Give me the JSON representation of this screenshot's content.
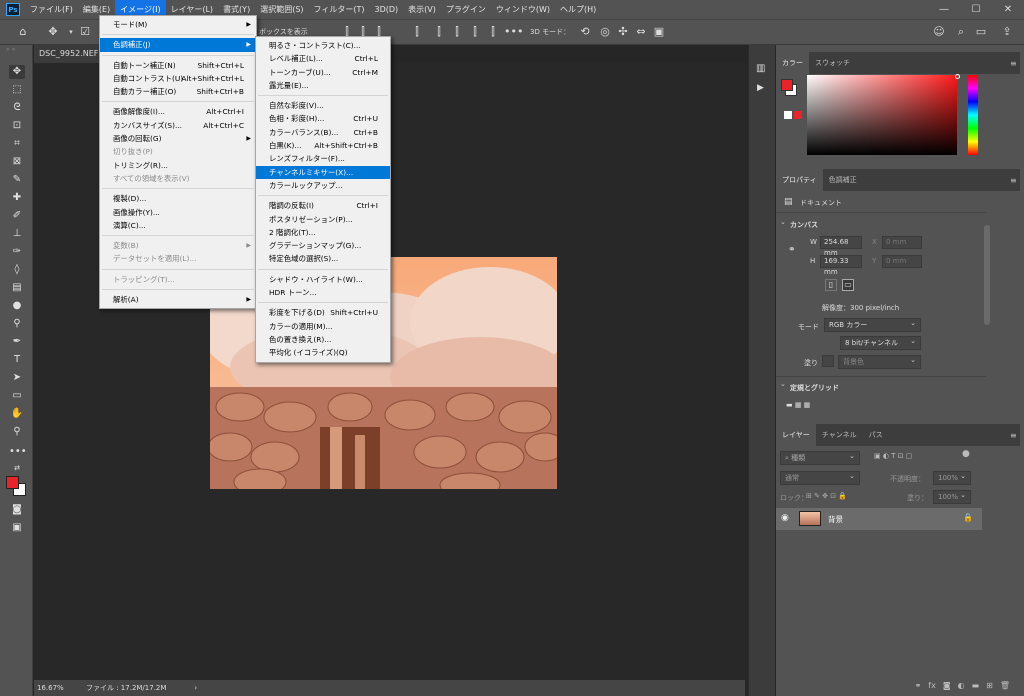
{
  "app": {
    "logo": "Ps"
  },
  "menubar": [
    "ファイル(F)",
    "編集(E)",
    "イメージ(I)",
    "レイヤー(L)",
    "書式(Y)",
    "選択範囲(S)",
    "フィルター(T)",
    "3D(D)",
    "表示(V)",
    "プラグイン",
    "ウィンドウ(W)",
    "ヘルプ(H)"
  ],
  "optionsbar": {
    "bbox_label": "ボックスを表示",
    "mode3d": "3D モード："
  },
  "document": {
    "tab": "DSC_9952.NEF @",
    "zoom": "16.67%",
    "file_info": "ファイル : 17.2M/17.2M"
  },
  "image_menu": [
    {
      "label": "モード(M)",
      "arrow": true
    },
    {
      "sep": true
    },
    {
      "label": "色調補正(J)",
      "arrow": true,
      "hl": true
    },
    {
      "sep": true
    },
    {
      "label": "自動トーン補正(N)",
      "sc": "Shift+Ctrl+L"
    },
    {
      "label": "自動コントラスト(U)",
      "sc": "Alt+Shift+Ctrl+L"
    },
    {
      "label": "自動カラー補正(O)",
      "sc": "Shift+Ctrl+B"
    },
    {
      "sep": true
    },
    {
      "label": "画像解像度(I)...",
      "sc": "Alt+Ctrl+I"
    },
    {
      "label": "カンバスサイズ(S)...",
      "sc": "Alt+Ctrl+C"
    },
    {
      "label": "画像の回転(G)",
      "arrow": true
    },
    {
      "label": "切り抜き(P)",
      "dis": true
    },
    {
      "label": "トリミング(R)..."
    },
    {
      "label": "すべての領域を表示(V)",
      "dis": true
    },
    {
      "sep": true
    },
    {
      "label": "複製(D)..."
    },
    {
      "label": "画像操作(Y)..."
    },
    {
      "label": "演算(C)..."
    },
    {
      "sep": true
    },
    {
      "label": "変数(B)",
      "arrow": true,
      "dis": true
    },
    {
      "label": "データセットを適用(L)...",
      "dis": true
    },
    {
      "sep": true
    },
    {
      "label": "トラッピング(T)...",
      "dis": true
    },
    {
      "sep": true
    },
    {
      "label": "解析(A)",
      "arrow": true
    }
  ],
  "adjust_menu": [
    {
      "label": "明るさ・コントラスト(C)..."
    },
    {
      "label": "レベル補正(L)...",
      "sc": "Ctrl+L"
    },
    {
      "label": "トーンカーブ(U)...",
      "sc": "Ctrl+M"
    },
    {
      "label": "露光量(E)..."
    },
    {
      "sep": true
    },
    {
      "label": "自然な彩度(V)..."
    },
    {
      "label": "色相・彩度(H)...",
      "sc": "Ctrl+U"
    },
    {
      "label": "カラーバランス(B)...",
      "sc": "Ctrl+B"
    },
    {
      "label": "白黒(K)...",
      "sc": "Alt+Shift+Ctrl+B"
    },
    {
      "label": "レンズフィルター(F)..."
    },
    {
      "label": "チャンネルミキサー(X)...",
      "hl": true
    },
    {
      "label": "カラールックアップ..."
    },
    {
      "sep": true
    },
    {
      "label": "階調の反転(I)",
      "sc": "Ctrl+I"
    },
    {
      "label": "ポスタリゼーション(P)..."
    },
    {
      "label": "2 階調化(T)..."
    },
    {
      "label": "グラデーションマップ(G)..."
    },
    {
      "label": "特定色域の選択(S)..."
    },
    {
      "sep": true
    },
    {
      "label": "シャドウ・ハイライト(W)..."
    },
    {
      "label": "HDR トーン..."
    },
    {
      "sep": true
    },
    {
      "label": "彩度を下げる(D)",
      "sc": "Shift+Ctrl+U"
    },
    {
      "label": "カラーの適用(M)..."
    },
    {
      "label": "色の置き換え(R)..."
    },
    {
      "label": "平均化 (イコライズ)(Q)"
    }
  ],
  "panels": {
    "color_tabs": [
      "カラー",
      "スウォッチ"
    ],
    "props_tabs": [
      "プロパティ",
      "色調補正"
    ],
    "doc_label": "ドキュメント",
    "canvas_section": "カンバス",
    "w_label": "W",
    "w_value": "254.68 mm",
    "x_label": "X",
    "x_value": "0 mm",
    "h_label": "H",
    "h_value": "169.33 mm",
    "y_label": "Y",
    "y_value": "0 mm",
    "resolution": "解像度：300 pixel/inch",
    "mode_label": "モード",
    "mode_value": "RGB カラー",
    "depth_value": "8 bit/チャンネル",
    "fill_label": "塗り",
    "fill_value": "背景色",
    "rulers_section": "定規とグリッド",
    "layers_tabs": [
      "レイヤー",
      "チャンネル",
      "パス"
    ],
    "search_kind": "種類",
    "blend_mode": "通常",
    "opacity_label": "不透明度：",
    "opacity_value": "100%",
    "lock_label": "ロック：",
    "fill2_label": "塗り：",
    "fill2_value": "100%",
    "layer_name": "背景"
  },
  "colors": {
    "accent": "#1473e6",
    "fg_swatch": "#e8242a",
    "bg_swatch": "#ffffff"
  }
}
